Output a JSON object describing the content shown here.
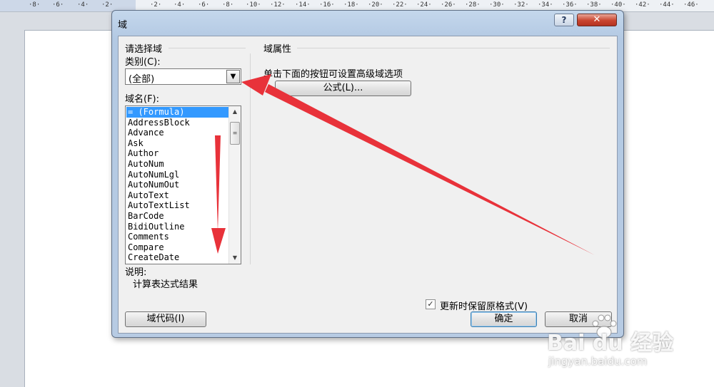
{
  "ruler": {
    "labels": [
      "8",
      "6",
      "4",
      "2",
      "2",
      "4",
      "6",
      "8",
      "10",
      "12",
      "14",
      "16",
      "18",
      "20",
      "22",
      "24",
      "26",
      "28",
      "30",
      "32",
      "34",
      "36",
      "38",
      "40",
      "42",
      "44",
      "46"
    ]
  },
  "dialog": {
    "title": "域",
    "help_label": "?",
    "close_label": "✕",
    "choose_field_heading": "请选择域",
    "categories_label": "类别(C):",
    "category_value": "(全部)",
    "field_names_label": "域名(F):",
    "field_names": [
      "= (Formula)",
      "AddressBlock",
      "Advance",
      "Ask",
      "Author",
      "AutoNum",
      "AutoNumLgl",
      "AutoNumOut",
      "AutoText",
      "AutoTextList",
      "BarCode",
      "BidiOutline",
      "Comments",
      "Compare",
      "CreateDate"
    ],
    "selected_index": 0,
    "description_label": "说明:",
    "description_text": "计算表达式结果",
    "field_properties_heading": "域属性",
    "advanced_hint": "单击下面的按钮可设置高级域选项",
    "formula_button": "公式(L)...",
    "preserve_format_label": "更新时保留原格式(V)",
    "preserve_format_checked": true,
    "field_codes_button": "域代码(I)",
    "ok_button": "确定",
    "cancel_button": "取消"
  },
  "watermark": {
    "brand": "Bai du 经验",
    "url": "jingyan.baidu.com"
  },
  "colors": {
    "selection": "#3399ff",
    "annotation_arrow": "#e8323a",
    "title_bar": "#b7cbe3",
    "close_button": "#c9452f"
  }
}
